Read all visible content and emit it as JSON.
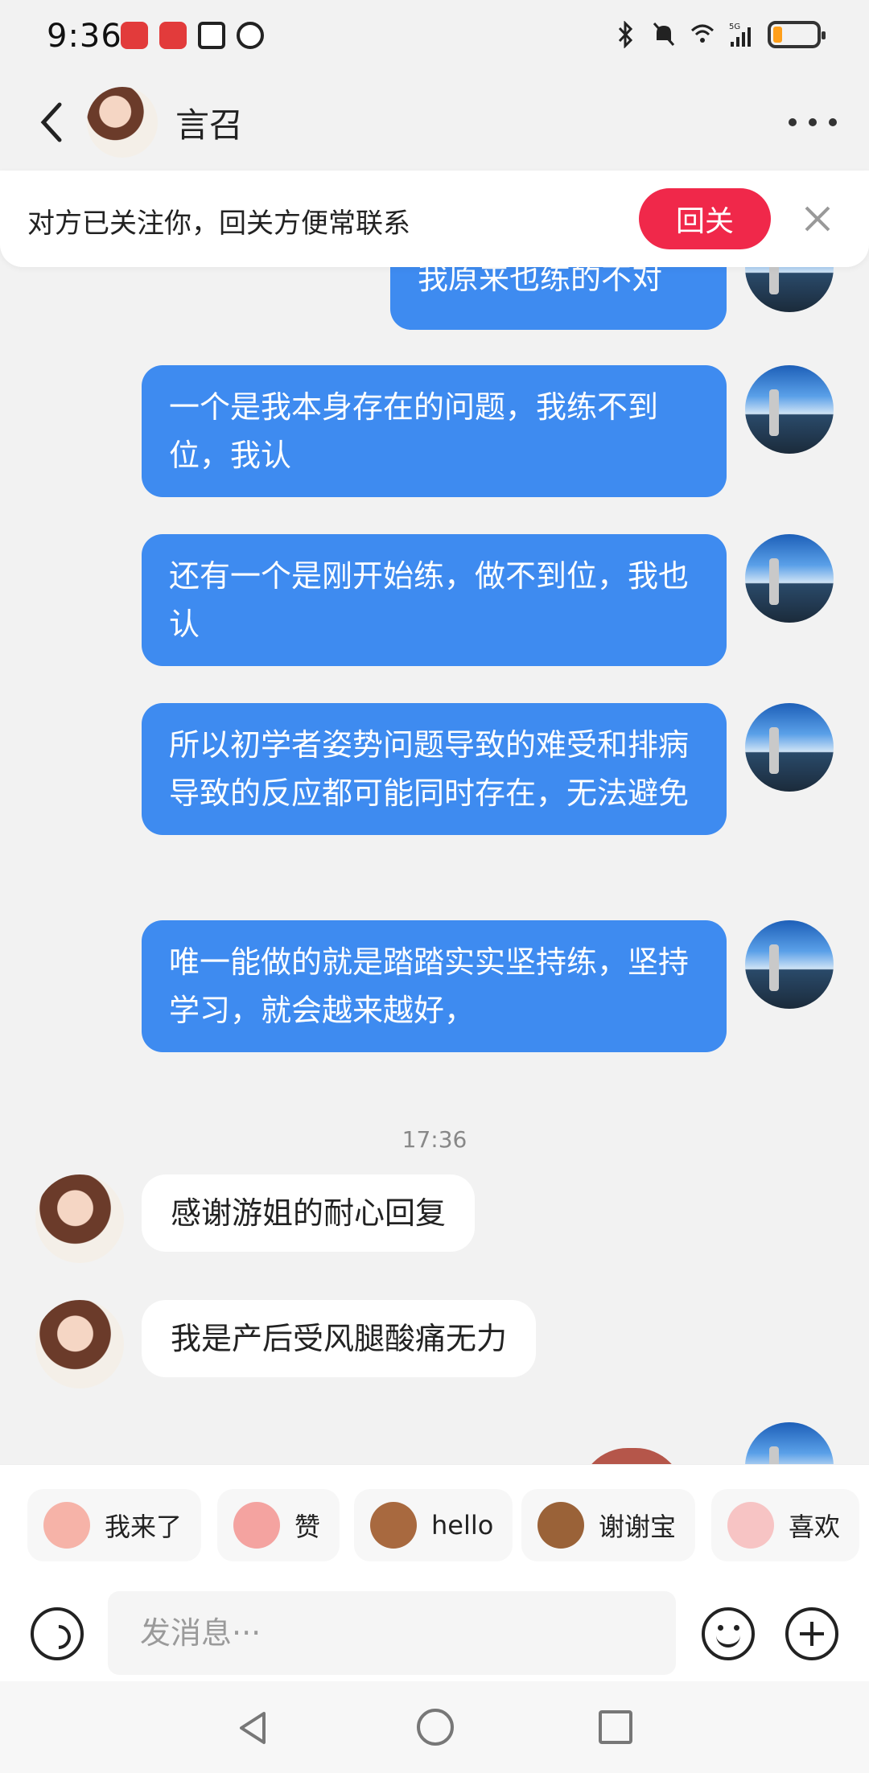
{
  "status_bar": {
    "time": "9:36",
    "network": "5G",
    "icons": [
      "app-notification-icon",
      "app-notification-icon",
      "nfc-icon",
      "alarm-icon",
      "bluetooth-icon",
      "mute-icon",
      "wifi-icon",
      "signal-icon",
      "battery-icon"
    ],
    "battery_level": 0.2,
    "battery_color": "#ff9f1a"
  },
  "header": {
    "contact_name": "言召",
    "back_icon": "chevron-left-icon",
    "more_icon": "more-dots-icon"
  },
  "follow_banner": {
    "text": "对方已关注你，回关方便常联系",
    "button_label": "回关",
    "button_color": "#f0284a"
  },
  "messages": [
    {
      "side": "out",
      "text": "我原来也练的不对"
    },
    {
      "side": "out",
      "text": "一个是我本身存在的问题，我练不到位，我认"
    },
    {
      "side": "out",
      "text": "还有一个是刚开始练，做不到位，我也认"
    },
    {
      "side": "out",
      "text": "所以初学者姿势问题导致的难受和排病导致的反应都可能同时存在，无法避免"
    },
    {
      "side": "out",
      "text": "唯一能做的就是踏踏实实坚持练，坚持学习，就会越来越好，"
    },
    {
      "side": "time",
      "text": "17:36"
    },
    {
      "side": "in",
      "text": "感谢游姐的耐心回复"
    },
    {
      "side": "in",
      "text": "我是产后受风腿酸痛无力"
    }
  ],
  "quick_replies": [
    {
      "label": "我来了",
      "icon": "sticker-icon"
    },
    {
      "label": "赞",
      "icon": "sticker-icon"
    },
    {
      "label": "hello",
      "icon": "sticker-icon"
    },
    {
      "label": "谢谢宝",
      "icon": "sticker-icon"
    },
    {
      "label": "喜欢",
      "icon": "sticker-icon"
    }
  ],
  "input_bar": {
    "placeholder": "发消息···",
    "voice_icon": "voice-icon",
    "emoji_icon": "emoji-icon",
    "plus_icon": "plus-icon"
  },
  "colors": {
    "outgoing_bubble": "#3e8bf0",
    "incoming_bubble": "#ffffff",
    "background": "#f2f2f2"
  }
}
